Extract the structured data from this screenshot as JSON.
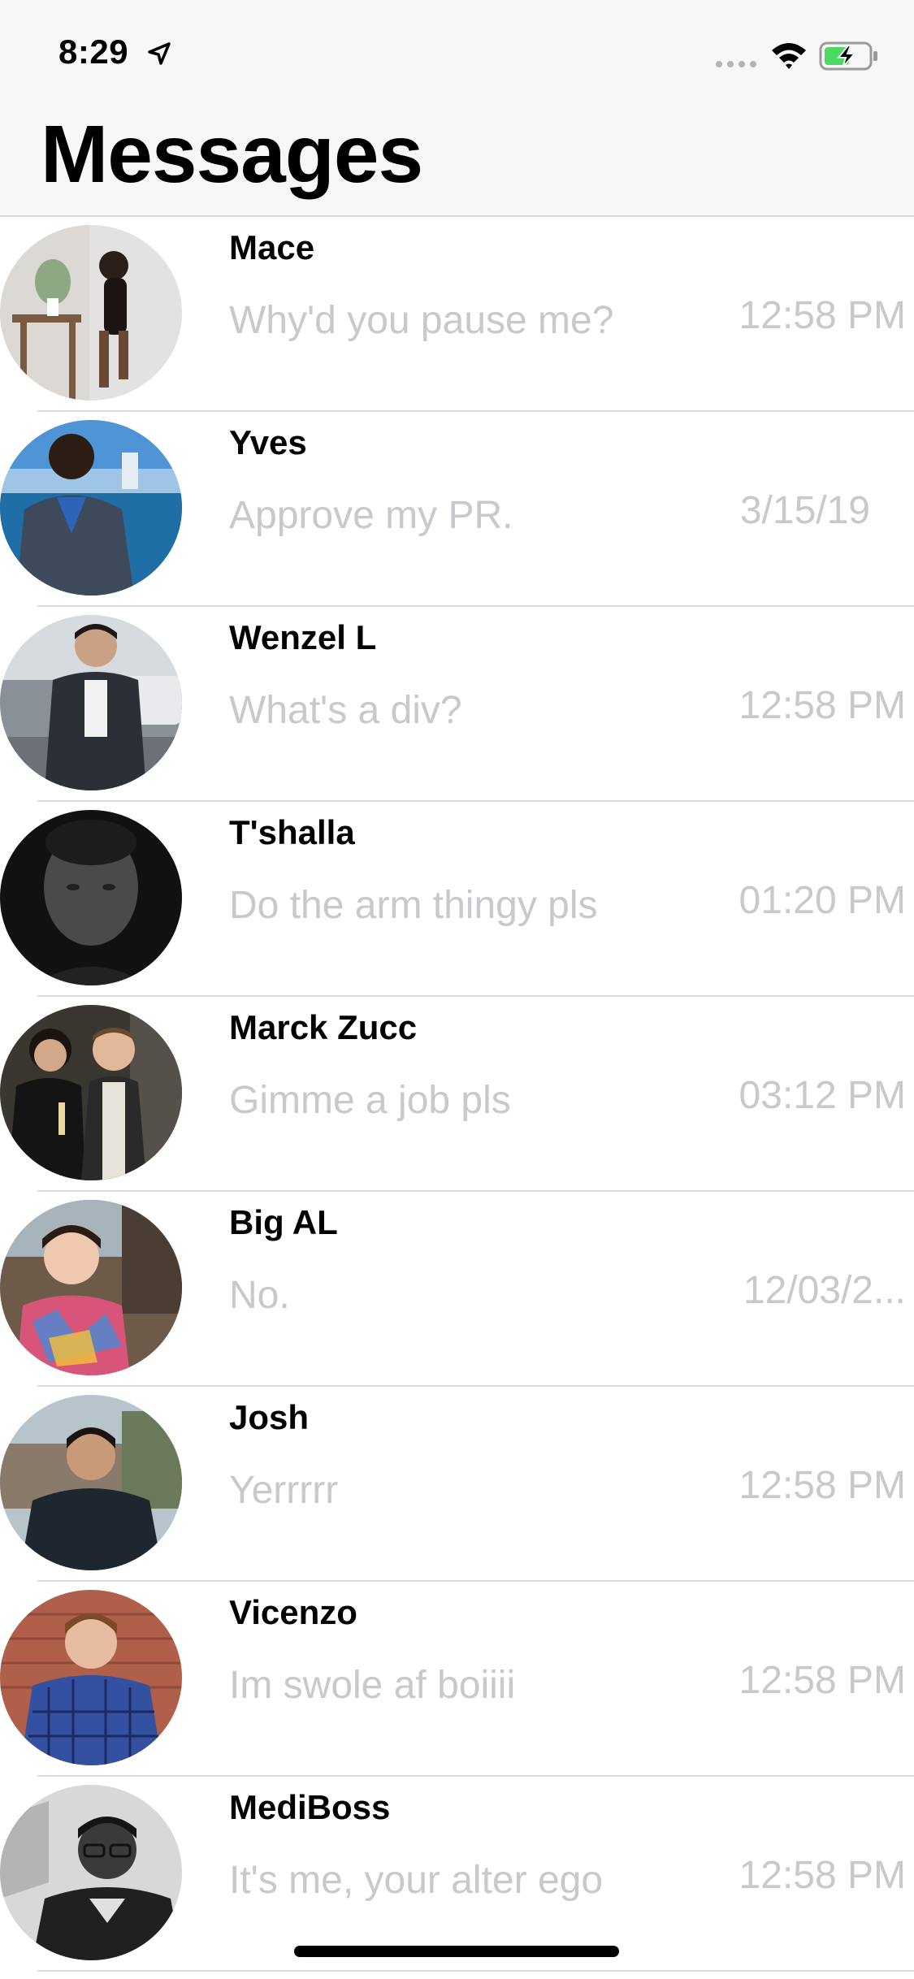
{
  "status_bar": {
    "time": "8:29",
    "icons": [
      "location-arrow-icon",
      "cellular-signal-icon",
      "wifi-icon",
      "battery-charging-icon"
    ]
  },
  "header": {
    "title": "Messages"
  },
  "colors": {
    "header_background": "#f7f7f7",
    "divider": "#dcdcdc",
    "secondary_text": "#c8c8cd",
    "battery_fill": "#4cd964"
  },
  "conversations": [
    {
      "name": "Mace",
      "preview": "Why'd you pause me?",
      "time": "12:58 PM"
    },
    {
      "name": "Yves",
      "preview": "Approve my PR.",
      "time": "3/15/19"
    },
    {
      "name": "Wenzel L",
      "preview": "What's a div?",
      "time": "12:58 PM"
    },
    {
      "name": "T'shalla",
      "preview": "Do the arm thingy pls",
      "time": "01:20 PM"
    },
    {
      "name": "Marck Zucc",
      "preview": "Gimme a job pls",
      "time": "03:12 PM"
    },
    {
      "name": "Big AL",
      "preview": "No.",
      "time": "12/03/2..."
    },
    {
      "name": "Josh",
      "preview": "Yerrrrr",
      "time": "12:58 PM"
    },
    {
      "name": "Vicenzo",
      "preview": "Im swole af boiiii",
      "time": "12:58 PM"
    },
    {
      "name": "MediBoss",
      "preview": "It's me, your alter ego",
      "time": "12:58 PM"
    }
  ]
}
